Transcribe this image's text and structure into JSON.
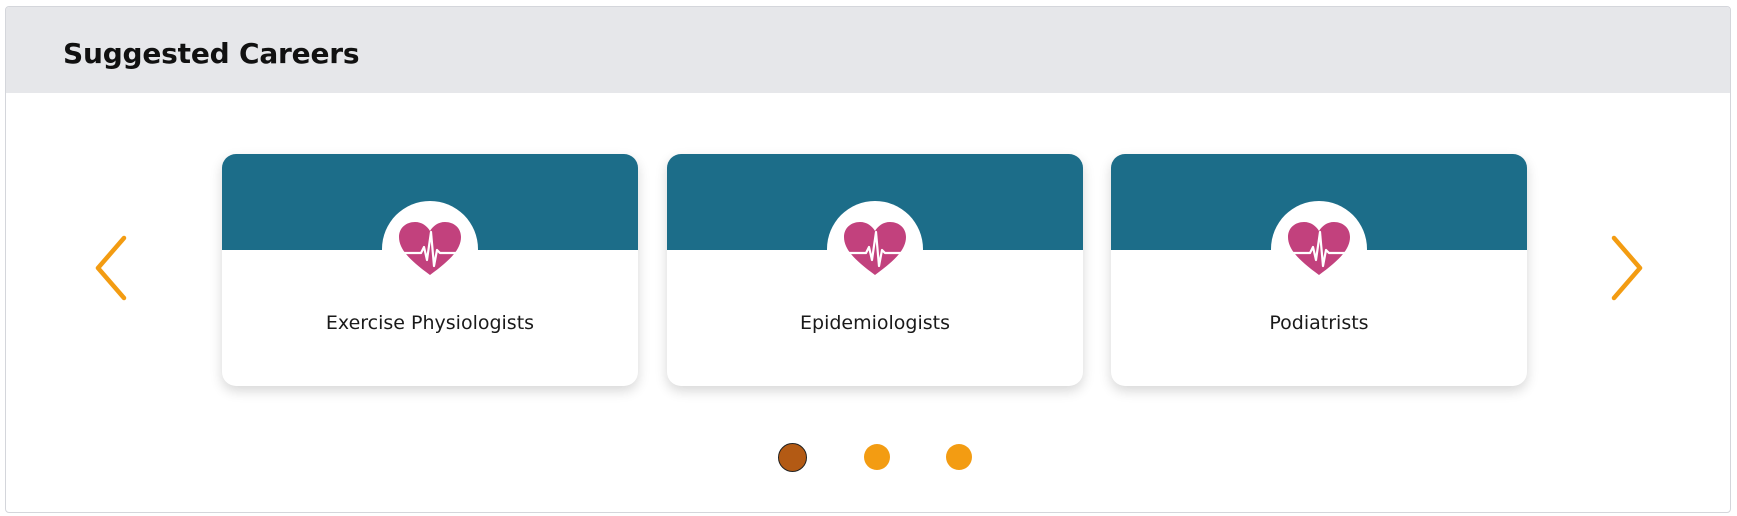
{
  "panel": {
    "title": "Suggested Careers"
  },
  "carousel": {
    "prev_icon": "chevron-left-icon",
    "next_icon": "chevron-right-icon",
    "cards": [
      {
        "label": "Exercise Physiologists",
        "icon": "heart-pulse-icon"
      },
      {
        "label": "Epidemiologists",
        "icon": "heart-pulse-icon"
      },
      {
        "label": "Podiatrists",
        "icon": "heart-pulse-icon"
      }
    ],
    "pagination": {
      "total_pages": 3,
      "active_page": 1
    }
  },
  "colors": {
    "header_bg": "#e6e7ea",
    "banner": "#1c6d89",
    "heart": "#c2417d",
    "arrow": "#f39c12",
    "dot": "#f39c12",
    "dot_active": "#b35a14"
  }
}
